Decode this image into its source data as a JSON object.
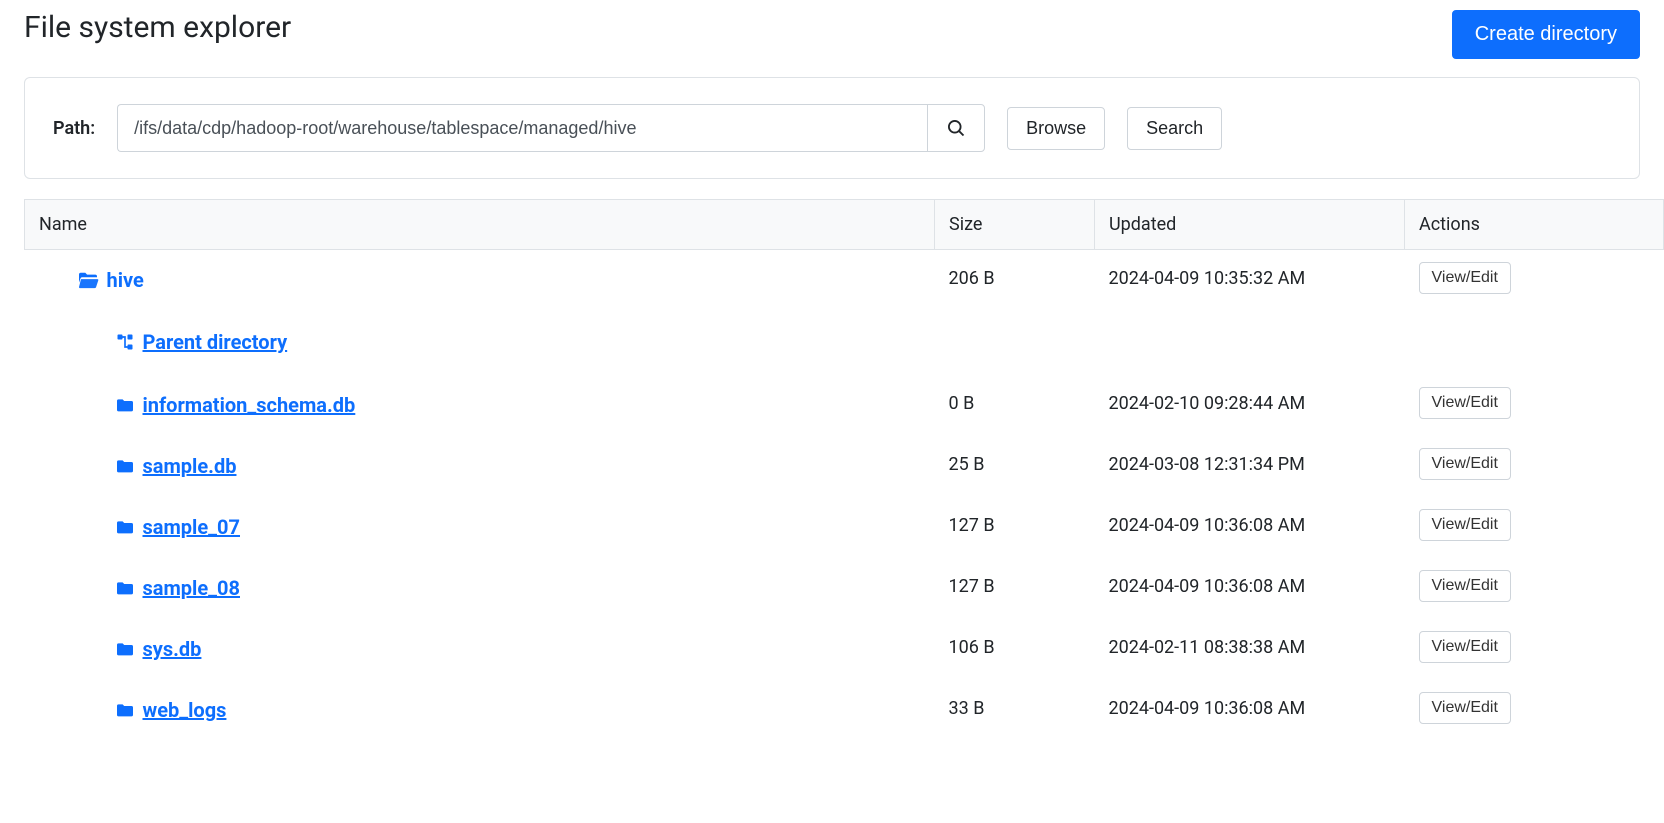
{
  "page": {
    "title": "File system explorer",
    "create_button": "Create directory"
  },
  "path_bar": {
    "label": "Path:",
    "value": "/ifs/data/cdp/hadoop-root/warehouse/tablespace/managed/hive",
    "browse": "Browse",
    "search": "Search"
  },
  "table": {
    "headers": {
      "name": "Name",
      "size": "Size",
      "updated": "Updated",
      "actions": "Actions"
    },
    "action_label": "View/Edit",
    "parent_label": "Parent directory",
    "root": {
      "name": "hive",
      "size": "206 B",
      "updated": "2024-04-09 10:35:32 AM"
    },
    "rows": [
      {
        "name": "information_schema.db",
        "size": "0 B",
        "updated": "2024-02-10 09:28:44 AM"
      },
      {
        "name": "sample.db",
        "size": "25 B",
        "updated": "2024-03-08 12:31:34 PM"
      },
      {
        "name": "sample_07",
        "size": "127 B",
        "updated": "2024-04-09 10:36:08 AM"
      },
      {
        "name": "sample_08",
        "size": "127 B",
        "updated": "2024-04-09 10:36:08 AM"
      },
      {
        "name": "sys.db",
        "size": "106 B",
        "updated": "2024-02-11 08:38:38 AM"
      },
      {
        "name": "web_logs",
        "size": "33 B",
        "updated": "2024-04-09 10:36:08 AM"
      }
    ]
  }
}
